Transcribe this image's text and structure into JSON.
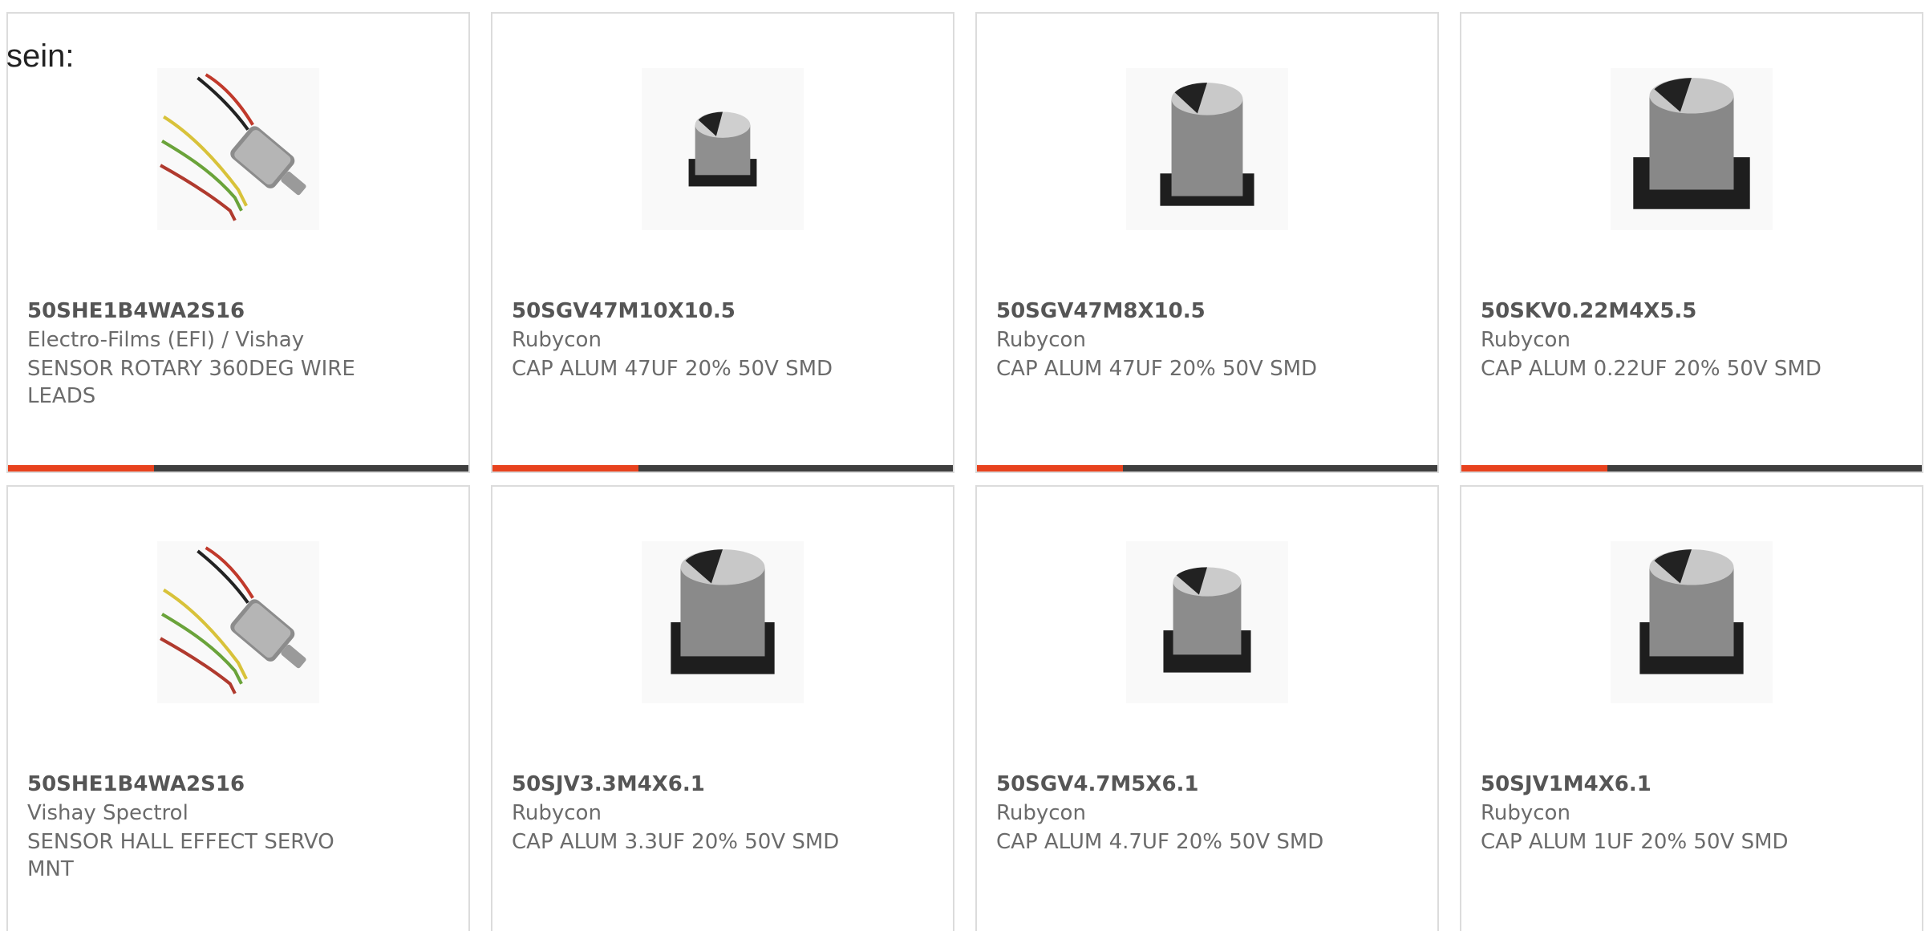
{
  "intro_text": "sein:",
  "accent_color": "#e8421e",
  "bar_color": "#3e3e3e",
  "products": [
    {
      "part_number": "50SHE1B4WA2S16",
      "manufacturer": "Electro-Films (EFI) / Vishay",
      "description": "SENSOR ROTARY 360DEG WIRE LEADS",
      "image": "rotary-sensor-image"
    },
    {
      "part_number": "50SGV47M10X10.5",
      "manufacturer": "Rubycon",
      "description": "CAP ALUM 47UF 20% 50V SMD",
      "image": "capacitor-image"
    },
    {
      "part_number": "50SGV47M8X10.5",
      "manufacturer": "Rubycon",
      "description": "CAP ALUM 47UF 20% 50V SMD",
      "image": "capacitor-image"
    },
    {
      "part_number": "50SKV0.22M4X5.5",
      "manufacturer": "Rubycon",
      "description": "CAP ALUM 0.22UF 20% 50V SMD",
      "image": "capacitor-image"
    },
    {
      "part_number": "50SHE1B4WA2S16",
      "manufacturer": "Vishay Spectrol",
      "description": "SENSOR HALL EFFECT SERVO MNT",
      "image": "rotary-sensor-image"
    },
    {
      "part_number": "50SJV3.3M4X6.1",
      "manufacturer": "Rubycon",
      "description": "CAP ALUM 3.3UF 20% 50V SMD",
      "image": "capacitor-image"
    },
    {
      "part_number": "50SGV4.7M5X6.1",
      "manufacturer": "Rubycon",
      "description": "CAP ALUM 4.7UF 20% 50V SMD",
      "image": "capacitor-image"
    },
    {
      "part_number": "50SJV1M4X6.1",
      "manufacturer": "Rubycon",
      "description": "CAP ALUM 1UF 20% 50V SMD",
      "image": "capacitor-image"
    }
  ]
}
